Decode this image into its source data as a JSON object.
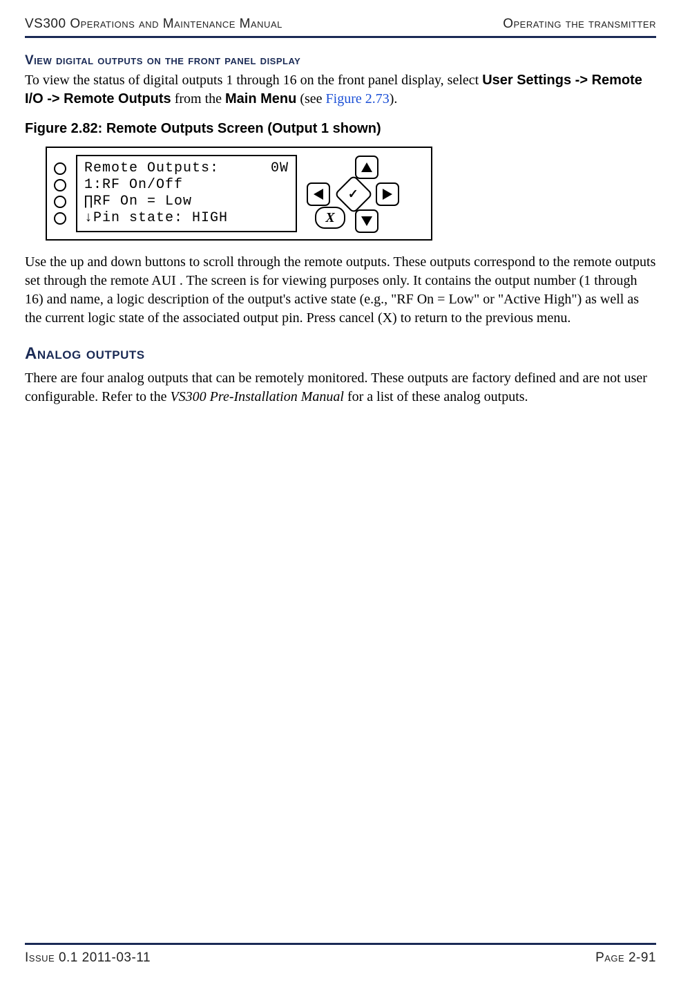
{
  "header": {
    "left": "VS300 Operations and Maintenance Manual",
    "right": "Operating the transmitter"
  },
  "section1": {
    "title": "View digital outputs on the front panel display",
    "p1_a": "To view the status of digital outputs 1 through 16 on the front panel display, select ",
    "p1_b": "User Settings -> Remote I/O -> Remote Outputs",
    "p1_c": " from the ",
    "p1_d": "Main Menu",
    "p1_e": " (see ",
    "p1_link": "Figure 2.73",
    "p1_f": ")."
  },
  "figure": {
    "caption": "Figure 2.82: Remote Outputs Screen (Output 1 shown)",
    "lcd": {
      "row1_left": "Remote Outputs:",
      "row1_right": "0W",
      "row2": "  1:RF On/Off",
      "row3": "∏RF On = Low",
      "row4": "↓Pin state: HIGH"
    },
    "buttons": {
      "ok": "✓",
      "cancel": "X"
    }
  },
  "section1_p2": "Use the up and down buttons to scroll through the remote outputs. These outputs correspond to the remote outputs set through the remote AUI . The screen is for viewing purposes only. It contains the output number (1 through 16) and name, a logic description of the output's active state (e.g., \"RF On = Low\" or \"Active High\") as well as the current logic state of the associated output pin. Press cancel (X) to return to the previous menu.",
  "section2": {
    "title": "Analog outputs",
    "p1_a": "There are four analog outputs that can be remotely monitored. These outputs are factory defined and are not user configurable. Refer to the ",
    "p1_italic": "VS300 Pre-Installation Manual",
    "p1_b": " for a list of these analog outputs."
  },
  "footer": {
    "left": "Issue 0.1  2011-03-11",
    "right": "Page 2-91"
  }
}
